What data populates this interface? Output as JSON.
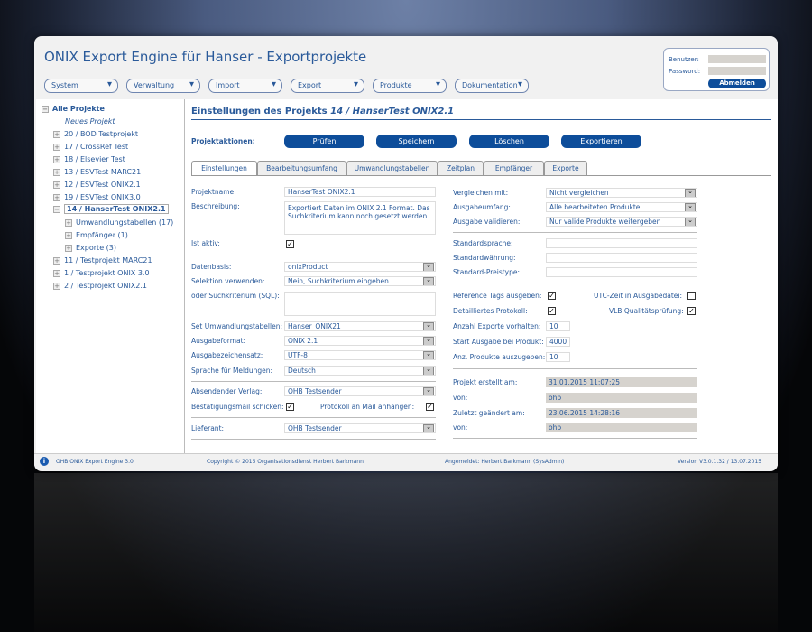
{
  "header": {
    "title": "ONIX Export Engine für Hanser - Exportprojekte",
    "menus": [
      "System",
      "Verwaltung",
      "Import",
      "Export",
      "Produkte",
      "Dokumentation"
    ]
  },
  "login": {
    "user_label": "Benutzer:",
    "password_label": "Password:",
    "logout": "Abmelden"
  },
  "tree": {
    "root": "Alle Projekte",
    "new": "Neues Projekt",
    "items": [
      "20 / BOD Testprojekt",
      "17 / CrossRef Test",
      "18 / Elsevier Test",
      "13 / ESVTest MARC21",
      "12 / ESVTest ONIX2.1",
      "19 / ESVTest ONIX3.0",
      "14 / HanserTest ONIX2.1"
    ],
    "children": [
      "Umwandlungstabellen (17)",
      "Empfänger (1)",
      "Exporte (3)"
    ],
    "after": [
      "11 / Testprojekt MARC21",
      "1 / Testprojekt ONIX 3.0",
      "2 / Testprojekt ONIX2.1"
    ]
  },
  "main": {
    "heading": "Einstellungen des Projekts",
    "heading_project": "14 / HanserTest ONIX2.1",
    "actions_label": "Projektaktionen:",
    "actions": [
      "Prüfen",
      "Speichern",
      "Löschen",
      "Exportieren"
    ],
    "tabs": [
      "Einstellungen",
      "Bearbeitungsumfang",
      "Umwandlungstabellen",
      "Zeitplan",
      "Empfänger",
      "Exporte"
    ]
  },
  "left": {
    "projektname": {
      "label": "Projektname:",
      "value": "HanserTest ONIX2.1"
    },
    "beschreibung": {
      "label": "Beschreibung:",
      "value": "Exportiert Daten im ONIX 2.1 Format. Das Suchkriterium kann noch gesetzt werden."
    },
    "aktiv": {
      "label": "Ist aktiv:",
      "checked": true
    },
    "datenbasis": {
      "label": "Datenbasis:",
      "value": "onixProduct"
    },
    "selektion": {
      "label": "Selektion verwenden:",
      "value": "Nein, Suchkriterium eingeben"
    },
    "sql": {
      "label": "oder Suchkriterium (SQL):",
      "value": ""
    },
    "set": {
      "label": "Set Umwandlungstabellen:",
      "value": "Hanser_ONIX21"
    },
    "format": {
      "label": "Ausgabeformat:",
      "value": "ONIX 2.1"
    },
    "charset": {
      "label": "Ausgabezeichensatz:",
      "value": "UTF-8"
    },
    "sprache": {
      "label": "Sprache für Meldungen:",
      "value": "Deutsch"
    },
    "verlag": {
      "label": "Absendender Verlag:",
      "value": "OHB Testsender"
    },
    "mail": {
      "label": "Bestätigungsmail schicken:",
      "checked": true
    },
    "protokoll": {
      "label": "Protokoll an Mail anhängen:",
      "checked": true
    },
    "lieferant": {
      "label": "Lieferant:",
      "value": "OHB Testsender"
    }
  },
  "right": {
    "vergleichen": {
      "label": "Vergleichen mit:",
      "value": "Nicht vergleichen"
    },
    "umfang": {
      "label": "Ausgabeumfang:",
      "value": "Alle bearbeiteten Produkte"
    },
    "validieren": {
      "label": "Ausgabe validieren:",
      "value": "Nur valide Produkte weitergeben"
    },
    "sprache": {
      "label": "Standardsprache:",
      "value": ""
    },
    "waehrung": {
      "label": "Standardwährung:",
      "value": ""
    },
    "preistype": {
      "label": "Standard-Preistype:",
      "value": ""
    },
    "reftags": {
      "label": "Reference Tags ausgeben:",
      "checked": true
    },
    "utc": {
      "label": "UTC-Zeit in Ausgabedatei:",
      "checked": false
    },
    "detail": {
      "label": "Detailliertes Protokoll:",
      "checked": true
    },
    "vlb": {
      "label": "VLB Qualitätsprüfung:",
      "checked": true
    },
    "anzahl": {
      "label": "Anzahl Exporte vorhalten:",
      "value": "10"
    },
    "start": {
      "label": "Start Ausgabe bei Produkt:",
      "value": "4000"
    },
    "anz": {
      "label": "Anz. Produkte auszugeben:",
      "value": "10"
    },
    "erstellt": {
      "label": "Projekt erstellt am:",
      "value": "31.01.2015 11:07:25"
    },
    "von1": {
      "label": "von:",
      "value": "ohb"
    },
    "geaendert": {
      "label": "Zuletzt geändert am:",
      "value": "23.06.2015 14:28:16"
    },
    "von2": {
      "label": "von:",
      "value": "ohb"
    }
  },
  "footer": {
    "app": "OHB ONIX Export Engine 3.0",
    "copyright": "Copyright © 2015 Organisationsdienst Herbert Barkmann",
    "user": "Angemeldet: Herbert Barkmann (SysAdmin)",
    "version": "Version V3.0.1.32 / 13.07.2015"
  }
}
